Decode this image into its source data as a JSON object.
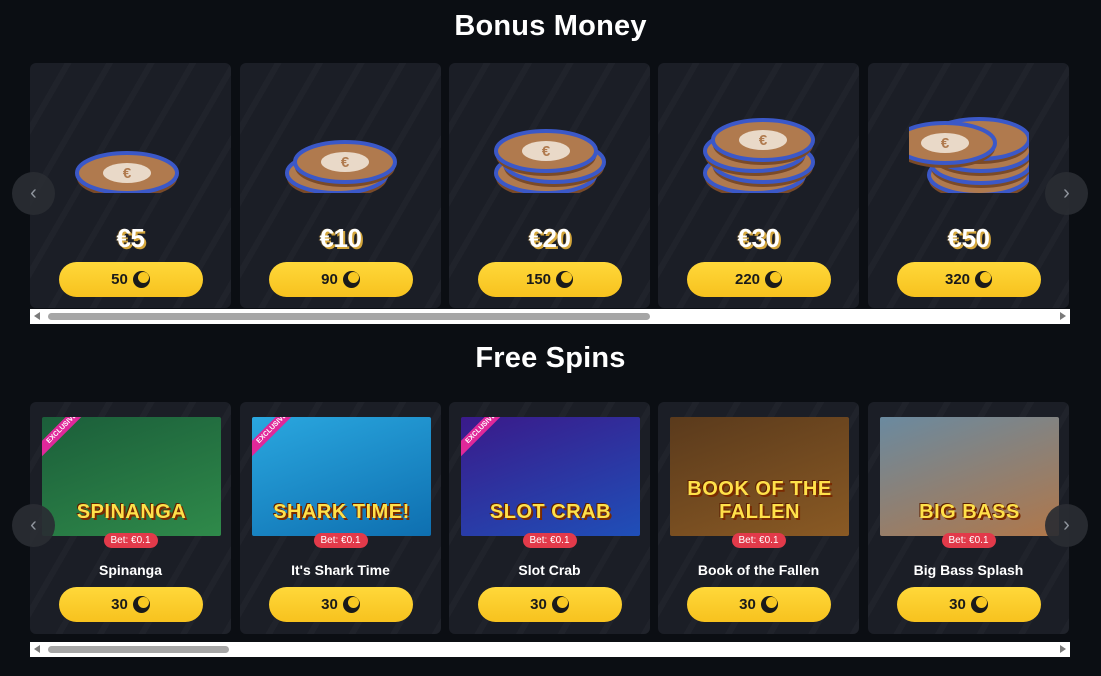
{
  "bonus_money": {
    "title": "Bonus Money",
    "items": [
      {
        "amount": "€5",
        "price": "50",
        "stack": 1
      },
      {
        "amount": "€10",
        "price": "90",
        "stack": 2
      },
      {
        "amount": "€20",
        "price": "150",
        "stack": 3
      },
      {
        "amount": "€30",
        "price": "220",
        "stack": 4
      },
      {
        "amount": "€50",
        "price": "320",
        "stack": 5
      }
    ],
    "scroll_fraction": 0.6
  },
  "free_spins": {
    "title": "Free Spins",
    "items": [
      {
        "name": "Spinanga",
        "logo": "SPINANGA",
        "bet": "Bet: €0.1",
        "price": "30",
        "exclusive": true,
        "exclusive_label": "EXCLUSIVE",
        "colors": [
          "#1b5e3a",
          "#2f8a4a"
        ]
      },
      {
        "name": "It's Shark Time",
        "logo": "SHARK TIME!",
        "bet": "Bet: €0.1",
        "price": "30",
        "exclusive": true,
        "exclusive_label": "EXCLUSIVE",
        "colors": [
          "#2aa7df",
          "#0e6fb0"
        ]
      },
      {
        "name": "Slot Crab",
        "logo": "SLOT CRAB",
        "bet": "Bet: €0.1",
        "price": "30",
        "exclusive": true,
        "exclusive_label": "EXCLUSIVE",
        "colors": [
          "#3a1a8a",
          "#1f4fb8"
        ]
      },
      {
        "name": "Book of the Fallen",
        "logo": "BOOK OF THE FALLEN",
        "bet": "Bet: €0.1",
        "price": "30",
        "exclusive": false,
        "exclusive_label": "",
        "colors": [
          "#5a3a1c",
          "#8a5a24"
        ]
      },
      {
        "name": "Big Bass Splash",
        "logo": "BIG BASS",
        "bet": "Bet: €0.1",
        "price": "30",
        "exclusive": false,
        "exclusive_label": "",
        "colors": [
          "#6a8aa0",
          "#b0774a"
        ]
      }
    ],
    "scroll_fraction": 0.18
  },
  "icons": {
    "prev": "chevron-left-icon",
    "next": "chevron-right-icon",
    "currency": "moon-coin-icon"
  },
  "colors": {
    "accent": "#f9c822",
    "bet_badge": "#e23a4a",
    "card": "#1b1e26",
    "background": "#0b0e13"
  }
}
